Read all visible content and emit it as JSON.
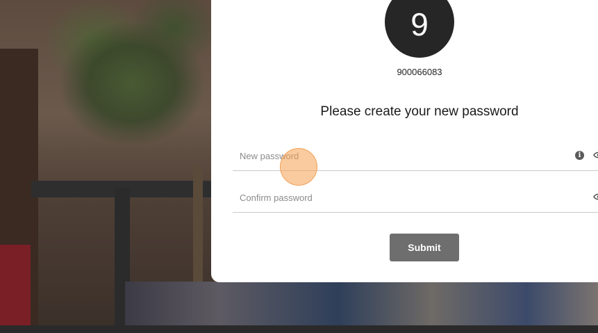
{
  "account": {
    "avatar_initial": "9",
    "id": "900066083"
  },
  "form": {
    "heading": "Please create your new password",
    "new_password": {
      "placeholder": "New password",
      "value": ""
    },
    "confirm_password": {
      "placeholder": "Confirm password",
      "value": ""
    },
    "submit_label": "Submit"
  },
  "icons": {
    "info": "info-icon",
    "reveal_new": "eye-icon",
    "reveal_confirm": "eye-icon"
  },
  "colors": {
    "avatar_bg": "#262626",
    "submit_bg": "#6e6e6e",
    "cursor_highlight": "#f6a050"
  }
}
